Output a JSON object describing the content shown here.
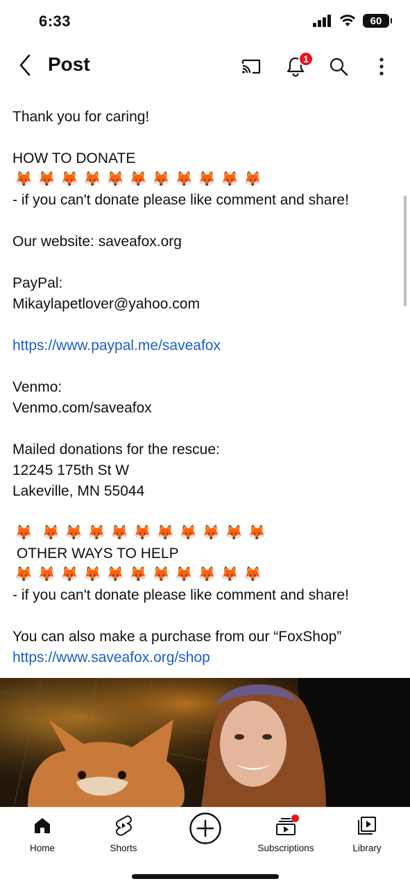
{
  "status": {
    "time": "6:33",
    "battery": "60"
  },
  "header": {
    "title": "Post",
    "notification_count": "1"
  },
  "post": {
    "thank_you": "Thank you for caring!",
    "donate_heading": "HOW TO DONATE",
    "share_note_1": "- if you can't donate please like comment and share!",
    "website_line": "Our website: saveafox.org",
    "paypal_label": "PayPal:",
    "paypal_email": "Mikaylapetlover@yahoo.com",
    "paypal_link": "https://www.paypal.me/saveafox",
    "venmo_label": "Venmo:",
    "venmo_value": "Venmo.com/saveafox",
    "mail_label": "Mailed donations for the rescue:",
    "mail_street": "12245 175th St W",
    "mail_city": "Lakeville, MN 55044",
    "other_heading": " OTHER WAYS TO HELP",
    "share_note_2": "- if you can't donate please like comment and share!",
    "shop_line": "You can also make a purchase from our “FoxShop”",
    "shop_link": "https://www.saveafox.org/shop",
    "fox_emoji": "🦊"
  },
  "nav": {
    "home": "Home",
    "shorts": "Shorts",
    "subscriptions": "Subscriptions",
    "library": "Library"
  },
  "colors": {
    "link": "#1a5fc6",
    "badge": "#e8131b"
  }
}
